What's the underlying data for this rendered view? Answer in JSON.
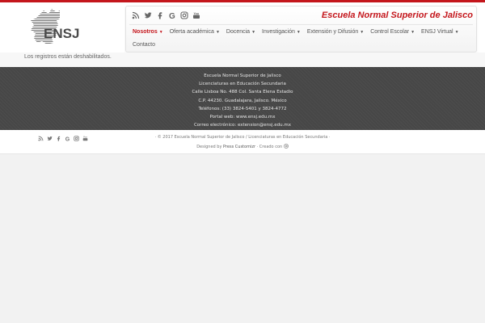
{
  "site": {
    "name": "Escuela Normal Superior de Jalisco",
    "logo_text": "ENSJ"
  },
  "colors": {
    "accent": "#c4161c",
    "footer_bg": "#474747"
  },
  "social_icons": [
    "rss-icon",
    "twitter-icon",
    "facebook-icon",
    "google-icon",
    "instagram-icon",
    "youtube-icon"
  ],
  "menu": {
    "items": [
      {
        "label": "Nosotros",
        "dropdown": true,
        "active": true
      },
      {
        "label": "Oferta académica",
        "dropdown": true
      },
      {
        "label": "Docencia",
        "dropdown": true
      },
      {
        "label": "Investigación",
        "dropdown": true
      },
      {
        "label": "Extensión y Difusión",
        "dropdown": true
      },
      {
        "label": "Control Escolar",
        "dropdown": true
      },
      {
        "label": "ENSJ Virtual",
        "dropdown": true
      },
      {
        "label": "Contacto",
        "dropdown": false
      }
    ]
  },
  "content": {
    "message": "Los registros están deshabilitados."
  },
  "footer": {
    "lines": [
      "Escuela Normal Superior de Jalisco",
      "Licenciaturas en Educación Secundaria",
      "Calle Lisboa No. 488 Col. Santa Elena Estadio",
      "C.P. 44230. Guadalajara, Jalisco. México",
      "Teléfonos: (33) 3824-5401 y 3824-4772",
      "Portal web: www.ensj.edu.mx",
      "Correo electrónico: extension@ensj.edu.mx"
    ],
    "copyright": "· © 2017 Escuela Normal Superior de Jalisco / Licenciaturas en Educación Secundaria ·",
    "designed_by_prefix": "Designed by",
    "designed_by_link": "Press Customizr",
    "created_with": "· Creado con"
  }
}
